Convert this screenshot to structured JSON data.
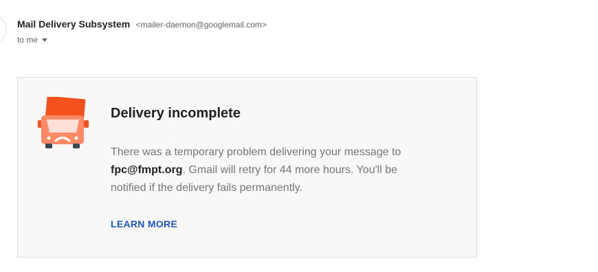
{
  "header": {
    "sender_name": "Mail Delivery Subsystem",
    "sender_email": "<mailer-daemon@googlemail.com>",
    "recipient_label": "to me"
  },
  "notice": {
    "icon": "sad-delivery-truck-icon",
    "title": "Delivery incomplete",
    "message_before": "There was a temporary problem delivering your message to ",
    "recipient_address": "fpc@fmpt.org",
    "message_after": ". Gmail will retry for 44 more hours. You'll be notified if the delivery fails permanently.",
    "learn_more_label": "LEARN MORE"
  },
  "colors": {
    "truck_primary": "#f4511e",
    "truck_body": "#ff8a65",
    "link": "#1a56c4",
    "card_background": "#f8f8f8"
  }
}
